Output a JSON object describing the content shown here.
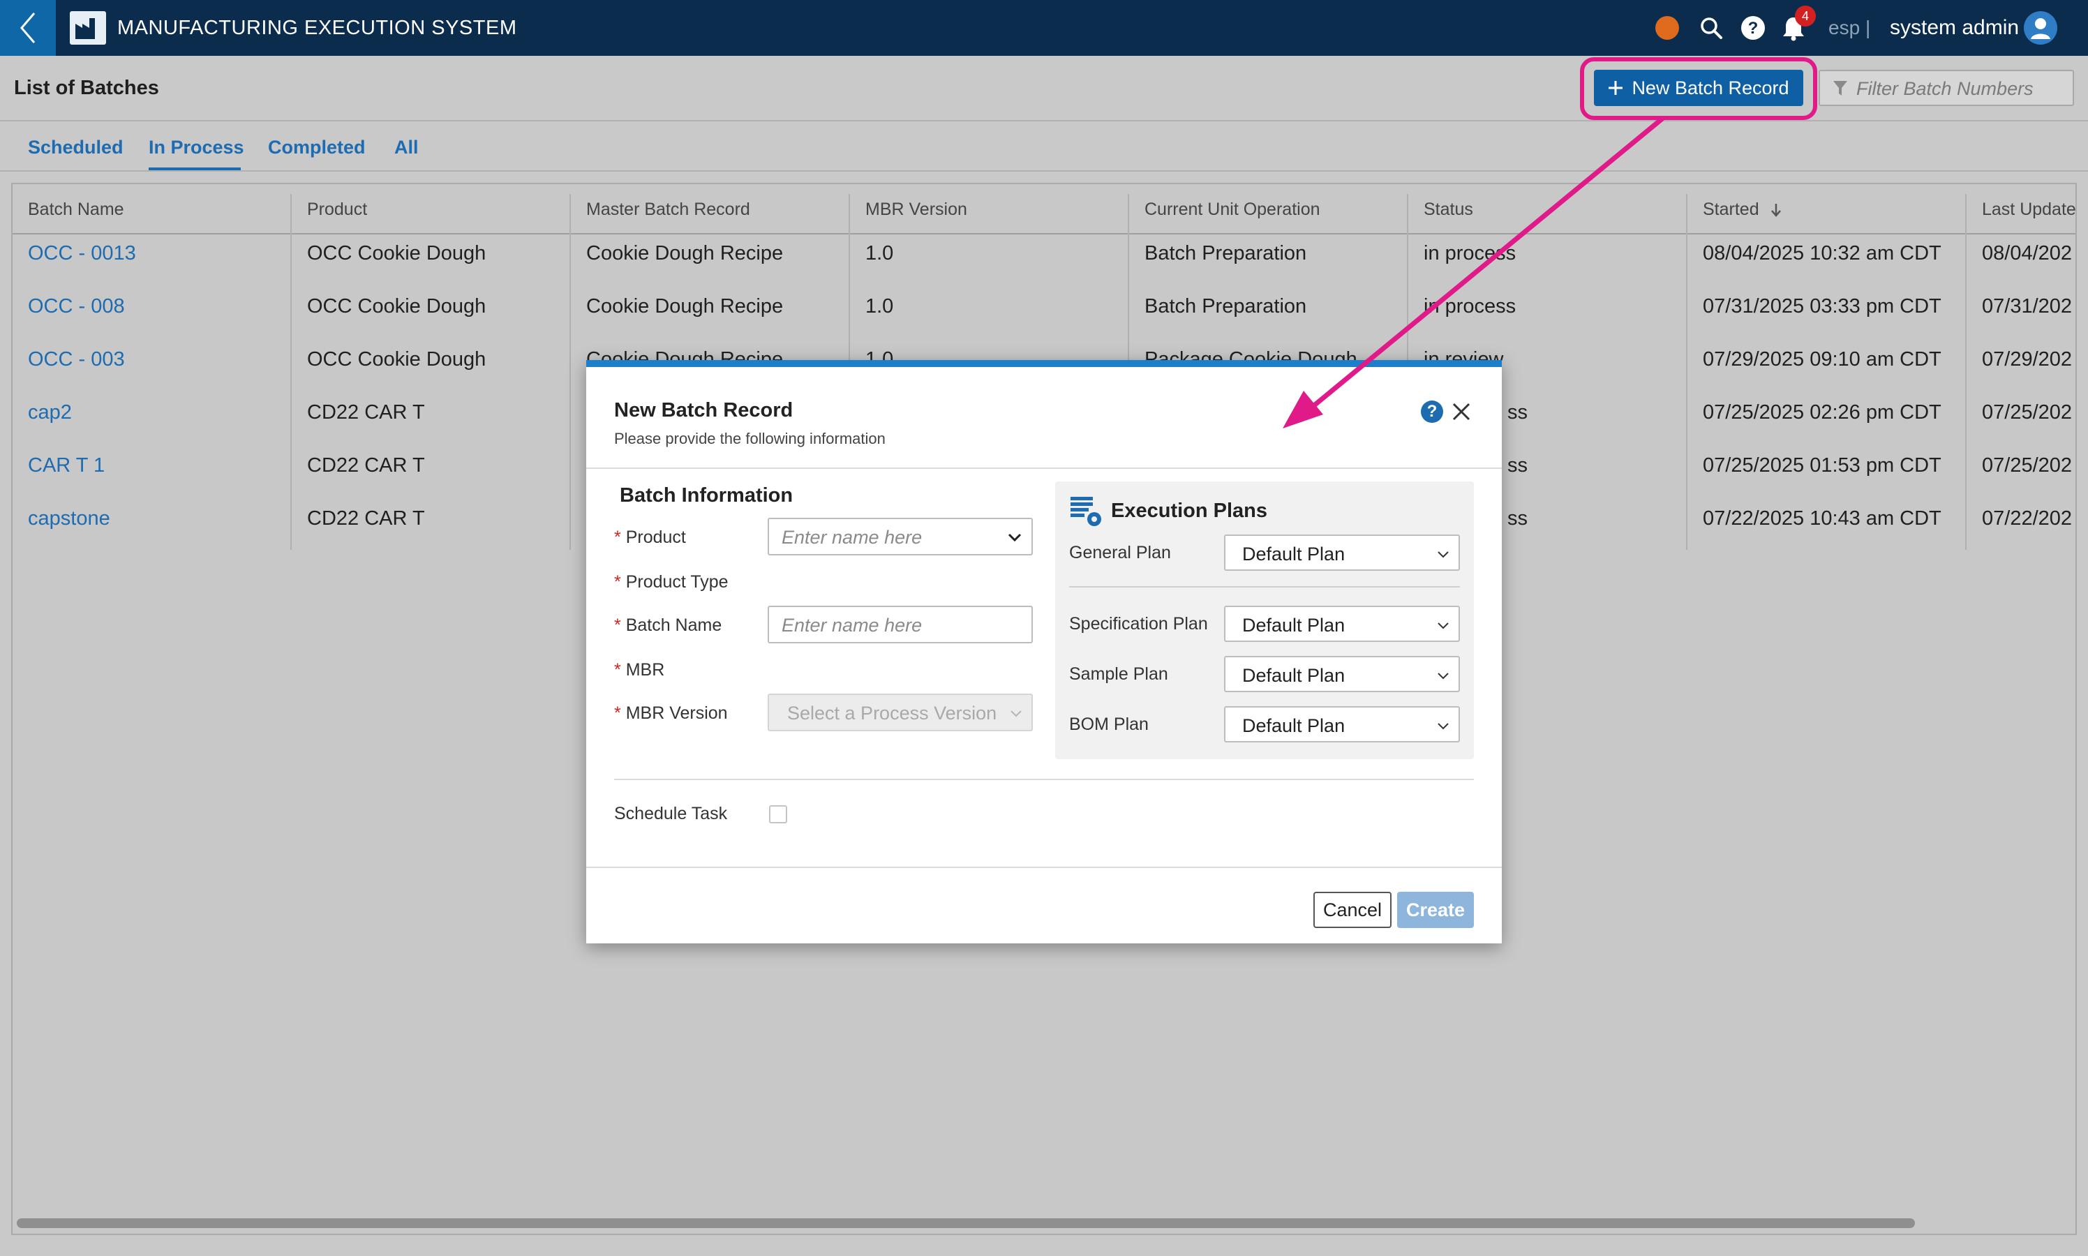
{
  "app": {
    "title": "MANUFACTURING EXECUTION SYSTEM",
    "notification_count": "4",
    "language": "esp",
    "separator": "|",
    "user": "system admin"
  },
  "page": {
    "title": "List of Batches",
    "new_batch_label": "New Batch Record",
    "filter_placeholder": "Filter Batch Numbers"
  },
  "tabs": [
    {
      "label": "Scheduled",
      "active": false
    },
    {
      "label": "In Process",
      "active": true
    },
    {
      "label": "Completed",
      "active": false
    },
    {
      "label": "All",
      "active": false
    }
  ],
  "table": {
    "columns": [
      "Batch Name",
      "Product",
      "Master Batch Record",
      "MBR Version",
      "Current Unit Operation",
      "Status",
      "Started",
      "Last Update"
    ],
    "sort_column": "Started",
    "sort_direction": "descending",
    "rows": [
      {
        "batch": "OCC - 0013",
        "product": "OCC Cookie Dough",
        "mbr": "Cookie Dough Recipe",
        "version": "1.0",
        "operation": "Batch Preparation",
        "status": "in process",
        "started": "08/04/2025 10:32 am CDT",
        "updated": "08/04/202"
      },
      {
        "batch": "OCC - 008",
        "product": "OCC Cookie Dough",
        "mbr": "Cookie Dough Recipe",
        "version": "1.0",
        "operation": "Batch Preparation",
        "status": "in process",
        "started": "07/31/2025 03:33 pm CDT",
        "updated": "07/31/202"
      },
      {
        "batch": "OCC - 003",
        "product": "OCC Cookie Dough",
        "mbr": "Cookie Dough Recipe",
        "version": "1.0",
        "operation": "Package Cookie Dough",
        "status": "in review",
        "started": "07/29/2025 09:10 am CDT",
        "updated": "07/29/202"
      },
      {
        "batch": "cap2",
        "product": "CD22 CAR T",
        "mbr": "",
        "version": "",
        "operation": "",
        "status": "ss",
        "started": "07/25/2025 02:26 pm CDT",
        "updated": "07/25/202"
      },
      {
        "batch": "CAR T 1",
        "product": "CD22 CAR T",
        "mbr": "",
        "version": "",
        "operation": "",
        "status": "ss",
        "started": "07/25/2025 01:53 pm CDT",
        "updated": "07/25/202"
      },
      {
        "batch": "capstone",
        "product": "CD22 CAR T",
        "mbr": "",
        "version": "",
        "operation": "",
        "status": "ss",
        "started": "07/22/2025 10:43 am CDT",
        "updated": "07/22/202"
      }
    ]
  },
  "modal": {
    "title": "New Batch Record",
    "subtitle": "Please provide the following information",
    "help": "?",
    "batch_info": {
      "title": "Batch Information",
      "required_mark": "*",
      "product_label": "Product",
      "product_placeholder": "Enter name here",
      "product_type_label": "Product Type",
      "batch_name_label": "Batch Name",
      "batch_name_placeholder": "Enter name here",
      "mbr_label": "MBR",
      "mbr_version_label": "MBR Version",
      "mbr_version_placeholder": "Select a Process Version"
    },
    "execution_plans": {
      "title": "Execution Plans",
      "plans": [
        {
          "label": "General Plan",
          "value": "Default Plan"
        },
        {
          "label": "Specification Plan",
          "value": "Default Plan"
        },
        {
          "label": "Sample Plan",
          "value": "Default Plan"
        },
        {
          "label": "BOM Plan",
          "value": "Default Plan"
        }
      ]
    },
    "schedule_task_label": "Schedule Task",
    "schedule_task_checked": false,
    "cancel_label": "Cancel",
    "create_label": "Create"
  },
  "colors": {
    "topbar": "#0b2c4d",
    "accent": "#1d6bb0",
    "annotation": "#e01a88",
    "status_dot": "#e06a1b",
    "badge": "#d32020"
  }
}
